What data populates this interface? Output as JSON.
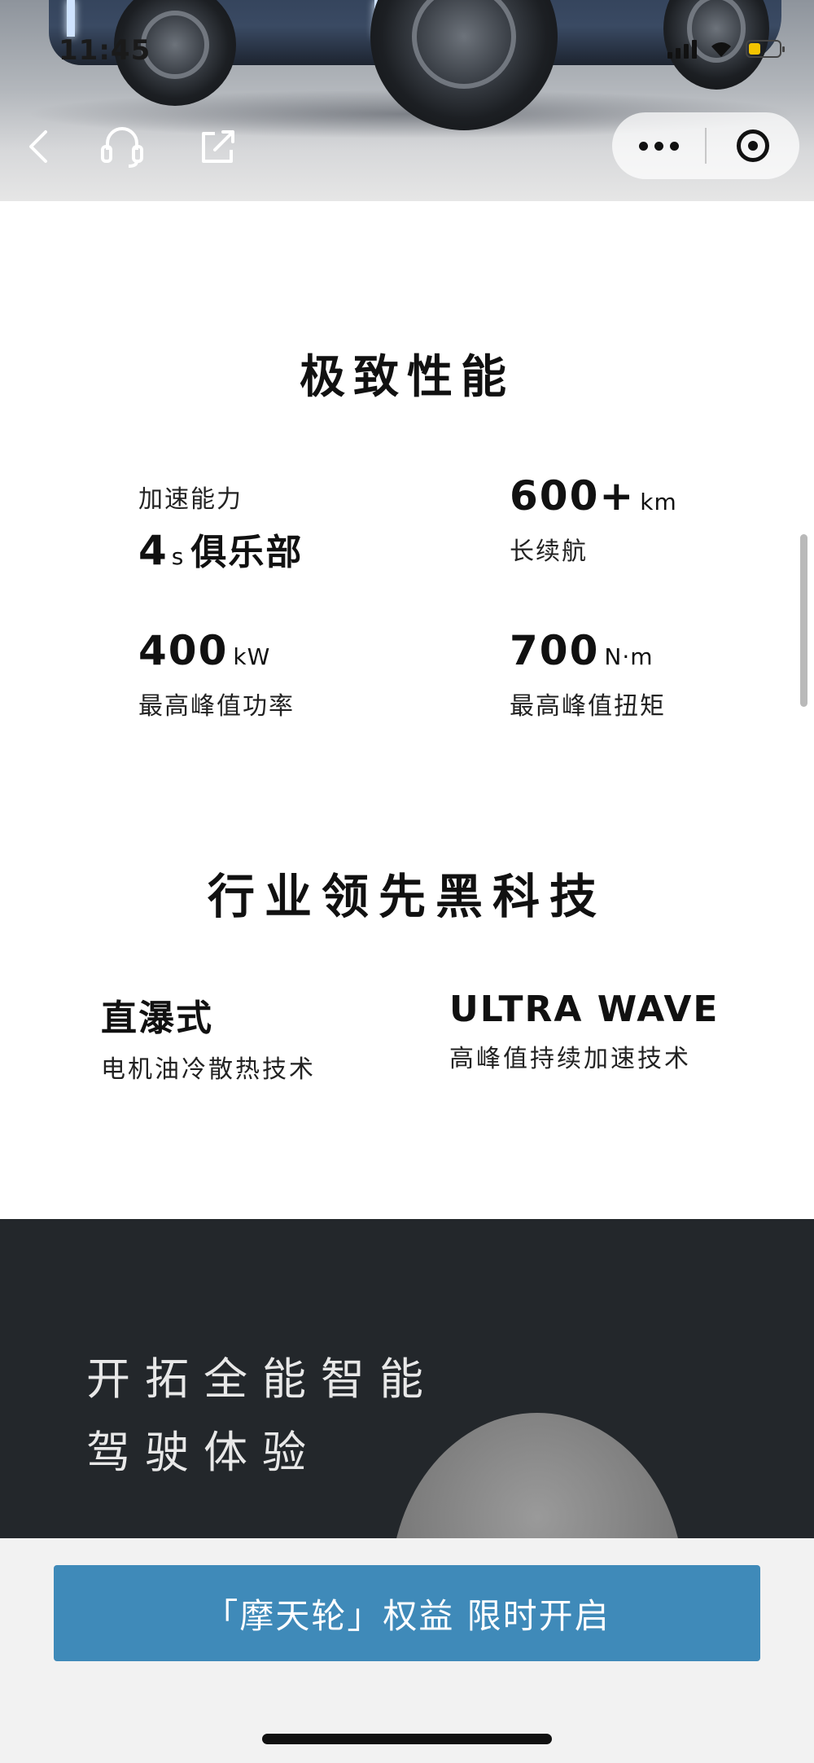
{
  "status_bar": {
    "time": "11:45"
  },
  "nav": {
    "back_icon": "chevron-left-icon",
    "service_icon": "headset-icon",
    "share_icon": "share-icon",
    "more_icon": "more-dots-icon",
    "close_icon": "miniprogram-close-icon"
  },
  "performance": {
    "title": "极致性能",
    "stats": [
      {
        "label": "加速能力",
        "value": "4",
        "unit": "s",
        "suffix": "俱乐部"
      },
      {
        "value": "600+",
        "unit": "km",
        "label": "长续航"
      },
      {
        "value": "400",
        "unit": "kW",
        "label": "最高峰值功率"
      },
      {
        "value": "700",
        "unit": "N·m",
        "label": "最高峰值扭矩"
      }
    ]
  },
  "tech": {
    "title": "行业领先黑科技",
    "items": [
      {
        "head": "直瀑式",
        "sub": "电机油冷散热技术"
      },
      {
        "head": "ULTRA WAVE",
        "sub": "高峰值持续加速技术"
      }
    ]
  },
  "driving": {
    "line1": "开拓全能智能",
    "line2": "驾驶体验"
  },
  "cta": {
    "label": "「摩天轮」权益 限时开启"
  },
  "colors": {
    "cta_bg": "#3f8ab9",
    "dark_bg": "#23272b"
  }
}
